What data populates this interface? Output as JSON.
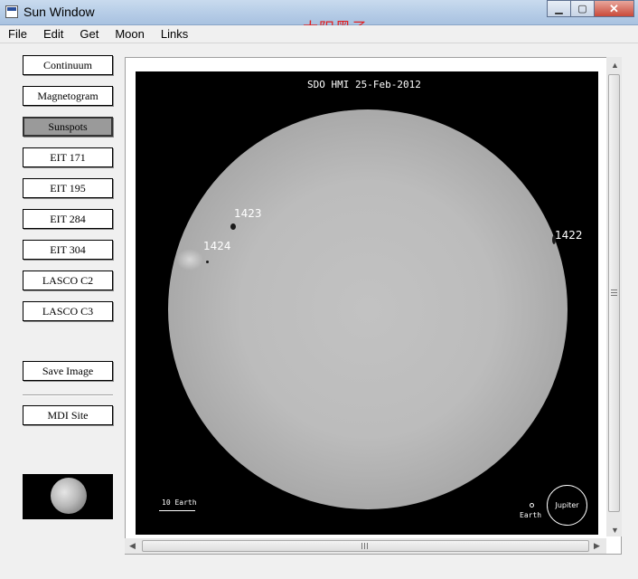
{
  "window": {
    "title": "Sun Window",
    "overlay_text": "太阳黑子",
    "controls": [
      "minimize-icon",
      "maximize-icon",
      "close-icon"
    ]
  },
  "menu": [
    "File",
    "Edit",
    "Get",
    "Moon",
    "Links"
  ],
  "sidebar": {
    "buttons": [
      "Continuum",
      "Magnetogram",
      "Sunspots",
      "EIT 171",
      "EIT 195",
      "EIT 284",
      "EIT 304",
      "LASCO C2",
      "LASCO C3"
    ],
    "active": "Sunspots",
    "save_label": "Save Image",
    "site_label": "MDI Site"
  },
  "image": {
    "caption": "SDO HMI  25-Feb-2012",
    "regions": [
      "1423",
      "1424",
      "1422"
    ],
    "scale_label": "10 Earth",
    "earth_label": "Earth",
    "jupiter_label": "Jupiter"
  },
  "colors": {
    "overlay_text": "#e02020",
    "active_button": "#9a9a9a"
  }
}
